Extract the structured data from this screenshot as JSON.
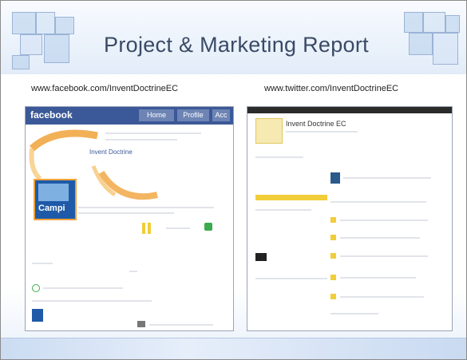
{
  "slide": {
    "title": "Project & Marketing Report"
  },
  "facebook": {
    "url": "www.facebook.com/InventDoctrineEC",
    "logo_text": "facebook",
    "nav_buttons": [
      "Home",
      "Profile",
      "Acc"
    ],
    "page_name_text": "Invent Doctrine",
    "logo_caption": "Campi"
  },
  "twitter": {
    "url": "www.twitter.com/InventDoctrineEC",
    "profile_name": "Invent Doctrine EC"
  },
  "colors": {
    "facebook_blue": "#3b5998",
    "accent_orange": "#f0a23a",
    "title_text": "#3a4a66"
  }
}
